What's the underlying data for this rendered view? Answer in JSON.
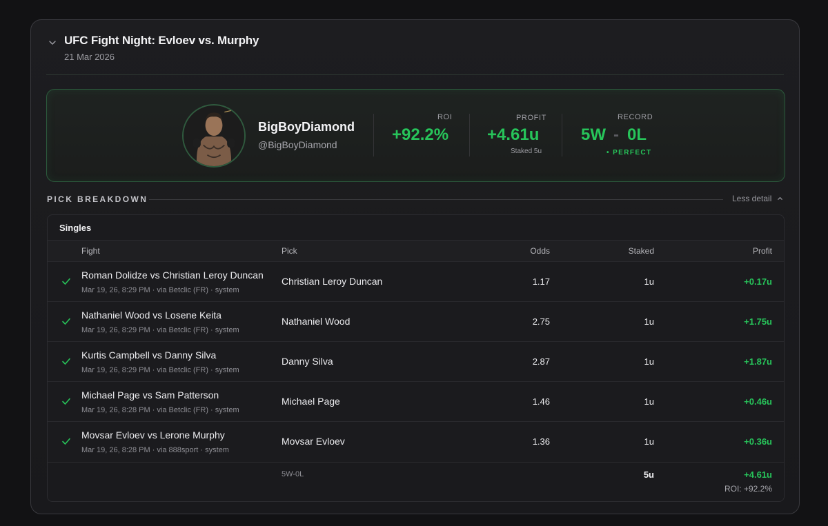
{
  "event": {
    "title": "UFC Fight Night: Evloev vs. Murphy",
    "date": "21 Mar 2026"
  },
  "user": {
    "name": "BigBoyDiamond",
    "handle": "@BigBoyDiamond"
  },
  "stats": {
    "roi_label": "ROI",
    "roi_value": "+92.2%",
    "profit_label": "PROFIT",
    "profit_value": "+4.61u",
    "profit_sub": "Staked 5u",
    "record_label": "RECORD",
    "record_wins": "5W",
    "record_dash": "-",
    "record_losses": "0L",
    "record_tag": "• PERFECT"
  },
  "breakdown": {
    "title": "PICK BREAKDOWN",
    "toggle_label": "Less detail",
    "section_label": "Singles",
    "columns": {
      "fight": "Fight",
      "pick": "Pick",
      "odds": "Odds",
      "staked": "Staked",
      "profit": "Profit"
    },
    "rows": [
      {
        "fight": "Roman Dolidze vs Christian Leroy Duncan",
        "meta": "Mar 19, 26, 8:29 PM · via Betclic (FR) · system",
        "pick": "Christian Leroy Duncan",
        "odds": "1.17",
        "staked": "1u",
        "profit": "+0.17u"
      },
      {
        "fight": "Nathaniel Wood vs Losene Keita",
        "meta": "Mar 19, 26, 8:29 PM · via Betclic (FR) · system",
        "pick": "Nathaniel Wood",
        "odds": "2.75",
        "staked": "1u",
        "profit": "+1.75u"
      },
      {
        "fight": "Kurtis Campbell vs Danny Silva",
        "meta": "Mar 19, 26, 8:29 PM · via Betclic (FR) · system",
        "pick": "Danny Silva",
        "odds": "2.87",
        "staked": "1u",
        "profit": "+1.87u"
      },
      {
        "fight": "Michael Page vs Sam Patterson",
        "meta": "Mar 19, 26, 8:28 PM · via Betclic (FR) · system",
        "pick": "Michael Page",
        "odds": "1.46",
        "staked": "1u",
        "profit": "+0.46u"
      },
      {
        "fight": "Movsar Evloev vs Lerone Murphy",
        "meta": "Mar 19, 26, 8:28 PM · via 888sport · system",
        "pick": "Movsar Evloev",
        "odds": "1.36",
        "staked": "1u",
        "profit": "+0.36u"
      }
    ],
    "footer": {
      "record": "5W-0L",
      "staked": "5u",
      "profit": "+4.61u",
      "roi": "ROI: +92.2%"
    }
  },
  "colors": {
    "accent_green": "#27c45a",
    "background": "#121214",
    "card": "#1d1d20"
  },
  "icons": {
    "collapse": "chevron-down-icon",
    "toggle": "chevron-up-icon",
    "win": "check-icon"
  }
}
